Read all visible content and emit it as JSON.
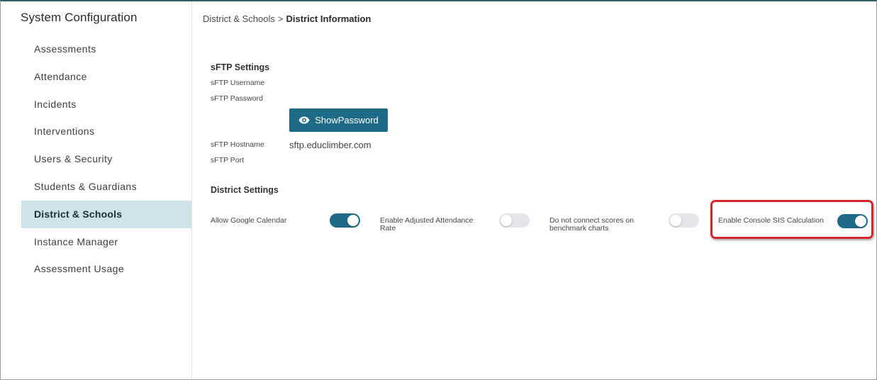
{
  "sidebar": {
    "title": "System Configuration",
    "items": [
      {
        "label": "Assessments",
        "active": false
      },
      {
        "label": "Attendance",
        "active": false
      },
      {
        "label": "Incidents",
        "active": false
      },
      {
        "label": "Interventions",
        "active": false
      },
      {
        "label": "Users & Security",
        "active": false
      },
      {
        "label": "Students & Guardians",
        "active": false
      },
      {
        "label": "District & Schools",
        "active": true
      },
      {
        "label": "Instance Manager",
        "active": false
      },
      {
        "label": "Assessment Usage",
        "active": false
      }
    ]
  },
  "breadcrumb": {
    "parent": "District & Schools",
    "separator": ">",
    "current": "District Information"
  },
  "sftp": {
    "title": "sFTP Settings",
    "username_label": "sFTP Username",
    "password_label": "sFTP Password",
    "show_password_label": "ShowPassword",
    "hostname_label": "sFTP Hostname",
    "hostname_value": "sftp.educlimber.com",
    "port_label": "sFTP Port"
  },
  "district_settings": {
    "title": "District Settings",
    "toggles": [
      {
        "label": "Allow Google Calendar",
        "on": true
      },
      {
        "label_line1": "Enable Adjusted Attendance",
        "label_line2": "Rate",
        "on": false
      },
      {
        "label_line1": "Do not connect scores on",
        "label_line2": "benchmark charts",
        "on": false
      },
      {
        "label": "Enable Console SIS Calculation",
        "on": true
      }
    ]
  },
  "colors": {
    "accent": "#1e6b87",
    "active_nav_bg": "#cde3e9",
    "highlight": "#d4262c"
  },
  "icons": {
    "show_password": "eye-icon"
  }
}
